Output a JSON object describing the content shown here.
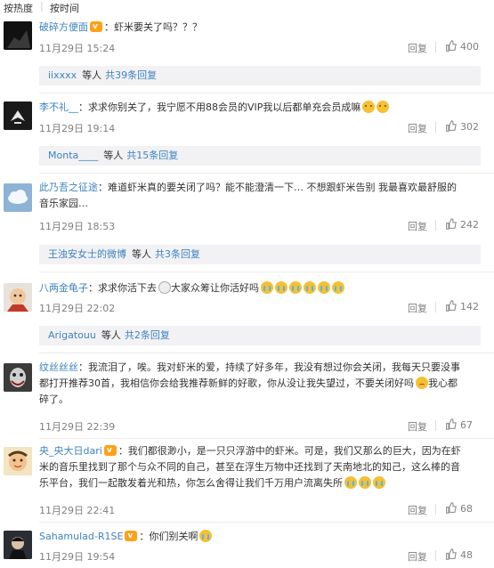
{
  "sort": {
    "hot": "按热度",
    "time": "按时间"
  },
  "comments": [
    {
      "user": "破碎方便面",
      "vip": true,
      "text": "：虾米要关了吗？？？",
      "extra": [],
      "time": "11月29日 15:24",
      "reply": "回复",
      "likes": "400",
      "sub": {
        "user": "iixxxx",
        "mid": "等人",
        "count": "共39条回复"
      }
    },
    {
      "user": "李不礼__",
      "vip": false,
      "text": "：求求你别关了，我宁愿不用88会员的VIP我以后都单充会员成嘛",
      "extra": [],
      "time": "11月29日 19:14",
      "reply": "回复",
      "likes": "302",
      "sub": {
        "user": "Monta____",
        "mid": "等人",
        "count": "共15条回复"
      }
    },
    {
      "user": "此乃吾之征途",
      "vip": false,
      "text": "：难道虾米真的要关闭了吗？能不能澄清一下… 不想跟虾米告别 我最喜欢最舒服的",
      "extra": [
        "音乐家园…"
      ],
      "time": "11月29日 18:53",
      "reply": "回复",
      "likes": "242",
      "sub": {
        "user": "王浊安女士的微博",
        "mid": "等人",
        "count": "共3条回复"
      }
    },
    {
      "user": "八两金龟子",
      "vip": false,
      "text": "：求求你活下去",
      "text2": "大家众筹让你活好吗",
      "extra": [],
      "time": "11月29日 22:02",
      "reply": "回复",
      "likes": "142",
      "sub": {
        "user": "Arigatouu",
        "mid": "等人",
        "count": "共2条回复"
      }
    },
    {
      "user": "纹丝丝丝",
      "vip": false,
      "text": "：我流泪了，唉。我对虾米的爱，持续了好多年，我没有想过你会关闭，我每天只要没事",
      "extra": [
        "都打开推荐30首，我相信你会给我推荐新鲜的好歌，你从没让我失望过，不要关闭好吗",
        "碎了。"
      ],
      "extra_tail": "我心都",
      "time": "11月29日 22:39",
      "reply": "回复",
      "likes": "67",
      "sub": null
    },
    {
      "user": "央_央大日dari",
      "vip": true,
      "text": "：我们都很渺小，是一只只浮游中的虾米。可是，我们又那么的巨大，因为在虾",
      "extra": [
        "米的音乐里找到了那个与众不同的自己，甚至在浮生万物中还找到了天南地北的知己，这么棒的音",
        "乐平台，我们一起散发着光和热，你怎么舍得让我们千万用户流离失所"
      ],
      "time": "11月29日 22:41",
      "reply": "回复",
      "likes": "68",
      "sub": null
    },
    {
      "user": "Sahamulad-R1SE",
      "vip": true,
      "text": "：你们别关啊",
      "extra": [],
      "time": "11月29日 19:54",
      "reply": "回复",
      "likes": "48",
      "sub": null
    }
  ]
}
